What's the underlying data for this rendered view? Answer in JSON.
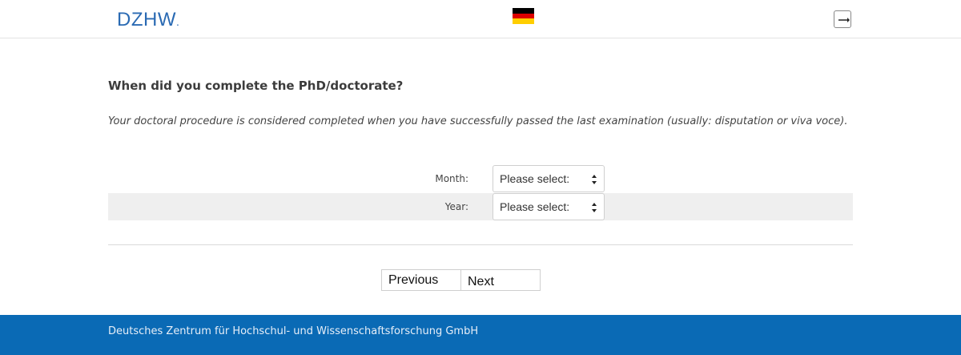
{
  "header": {
    "logo_text": "DZHW",
    "logo_dot": ".",
    "language_flag_icon": "german-flag-icon",
    "logout_icon": "logout-icon"
  },
  "question": {
    "title": "When did you complete the PhD/doctorate?",
    "instruction": "Your doctoral procedure is considered completed when you have successfully passed the last examination (usually: disputation or viva voce)."
  },
  "form": {
    "month": {
      "label": "Month:",
      "value": "Please select:"
    },
    "year": {
      "label": "Year:",
      "value": "Please select:"
    }
  },
  "navigation": {
    "previous_label": "Previous",
    "next_label": "Next"
  },
  "footer": {
    "text": "Deutsches Zentrum für Hochschul- und Wissenschaftsforschung GmbH"
  },
  "colors": {
    "brand_blue": "#0a6ab5",
    "logo_blue": "#2a6ab3",
    "row_highlight": "#efefef"
  }
}
